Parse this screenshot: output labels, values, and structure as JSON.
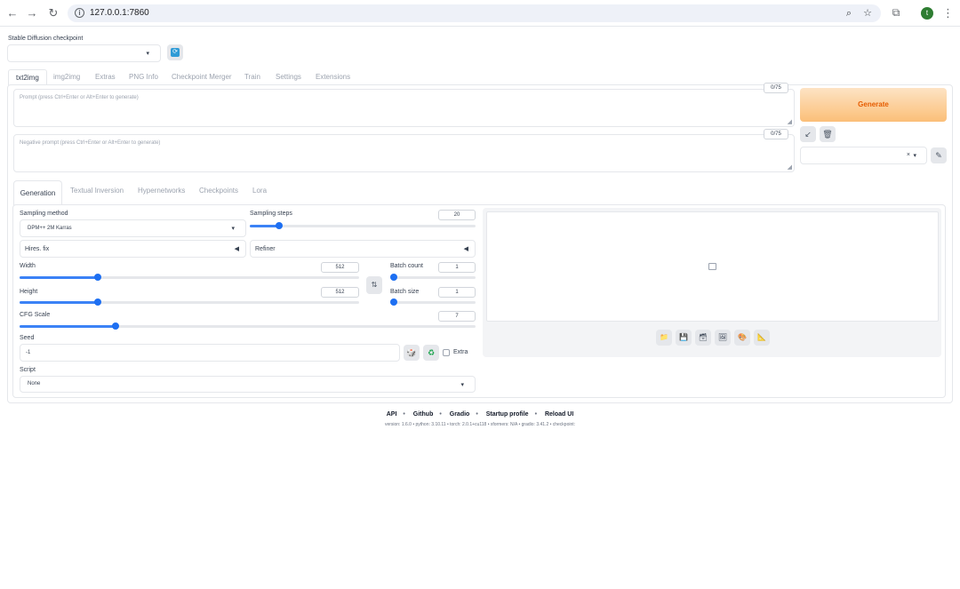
{
  "browser": {
    "url": "127.0.0.1:7860",
    "profile_initial": "t"
  },
  "checkpoint": {
    "label": "Stable Diffusion checkpoint",
    "value": ""
  },
  "top_tabs": [
    "txt2img",
    "img2img",
    "Extras",
    "PNG Info",
    "Checkpoint Merger",
    "Train",
    "Settings",
    "Extensions"
  ],
  "prompt": {
    "placeholder": "Prompt (press Ctrl+Enter or Alt+Enter to generate)",
    "token_count": "0/75"
  },
  "negative_prompt": {
    "placeholder": "Negative prompt (press Ctrl+Enter or Alt+Enter to generate)",
    "token_count": "0/75"
  },
  "generate_label": "Generate",
  "style_clear": "×",
  "sub_tabs": [
    "Generation",
    "Textual Inversion",
    "Hypernetworks",
    "Checkpoints",
    "Lora"
  ],
  "sampling_method": {
    "label": "Sampling method",
    "value": "DPM++ 2M Karras"
  },
  "sampling_steps": {
    "label": "Sampling steps",
    "value": "20",
    "fraction": 0.13
  },
  "hires_fix": "Hires. fix",
  "refiner": "Refiner",
  "width": {
    "label": "Width",
    "value": "512",
    "fraction": 0.23
  },
  "height": {
    "label": "Height",
    "value": "512",
    "fraction": 0.23
  },
  "batch_count": {
    "label": "Batch count",
    "value": "1",
    "fraction": 0.0
  },
  "batch_size": {
    "label": "Batch size",
    "value": "1",
    "fraction": 0.0
  },
  "cfg_scale": {
    "label": "CFG Scale",
    "value": "7",
    "fraction": 0.21
  },
  "seed": {
    "label": "Seed",
    "value": "-1",
    "extra_label": "Extra"
  },
  "script": {
    "label": "Script",
    "value": "None"
  },
  "footer": {
    "links": [
      "API",
      "Github",
      "Gradio",
      "Startup profile",
      "Reload UI"
    ],
    "version_line": "version: 1.6.0  •  python: 3.10.11  •  torch: 2.0.1+cu118  •  xformers: N/A  •  gradio: 3.41.2  •  checkpoint:"
  },
  "colors": {
    "accent": "#1d6ff2",
    "generate_text": "#e65c00"
  }
}
